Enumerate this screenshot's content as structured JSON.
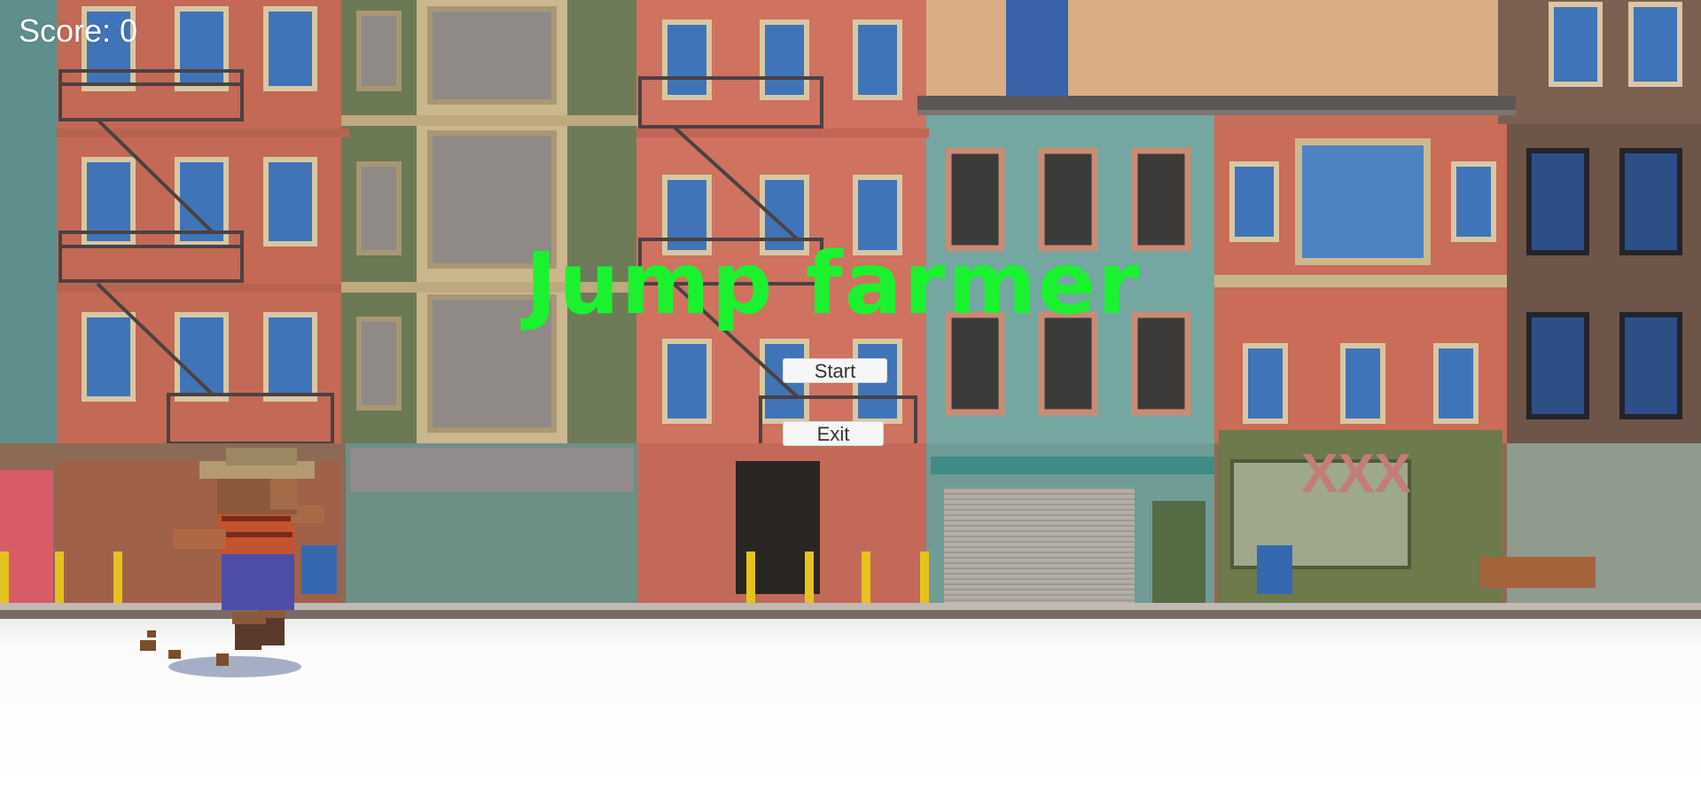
{
  "hud": {
    "score_text": "Score: 0"
  },
  "menu": {
    "title": "Jump farmer",
    "start_label": "Start",
    "exit_label": "Exit"
  },
  "scene": {
    "store_sign": "XXX",
    "colors": {
      "title": "#1bf22f",
      "ground": "#fefefe",
      "brick_red": "#c86a57",
      "olive_green": "#6d7a55",
      "tan": "#c8b78d",
      "teal": "#6fa39c",
      "dark_brown": "#6b5348",
      "window_blue": "#3f74b8"
    }
  }
}
